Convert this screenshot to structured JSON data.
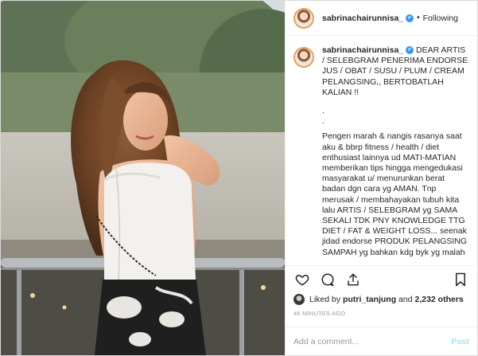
{
  "post": {
    "username": "sabrinachairunnisa_",
    "follow_status": "Following",
    "separator": "•",
    "verified_badge": "✔",
    "caption_lead": "DEAR ARTIS / SELEBGRAM PENERIMA ENDORSE JUS / OBAT / SUSU / PLUM / CREAM PELANGSING,, BERTOBATLAH KALIAN !!",
    "caption_dots": ".\n.",
    "caption_body": "Pengen marah & nangis rasanya saat aku & bbrp fitness / health / diet enthusiast lainnya ud MATI-MATIAN memberikan tips hingga mengedukasi masyarakat u/ menurunkan berat badan dgn cara yg AMAN. Tnp merusak / membahayakan tubuh kita lalu ARTIS / SELEBGRAM yg SAMA SEKALI TDK PNY KNOWLEDGE TTG DIET / FAT & WEIGHT LOSS... seenak jidad endorse PRODUK PELANGSING SAMPAH yg bahkan kdg byk yg malah",
    "liked_prefix": "Liked by",
    "liked_user": "putri_tanjung",
    "liked_and": "and",
    "liked_others": "2,232 others",
    "timestamp": "46 MINUTES AGO",
    "comment_placeholder": "Add a comment...",
    "post_button": "Post"
  },
  "icons": {
    "avatar": "avatar",
    "like": "heart-icon",
    "comment": "comment-icon",
    "share": "share-icon",
    "save": "bookmark-icon",
    "verified": "verified-badge-icon"
  },
  "colors": {
    "verified": "#3897f0",
    "post_button": "#b2dffc",
    "muted": "#999999",
    "text": "#262626"
  }
}
